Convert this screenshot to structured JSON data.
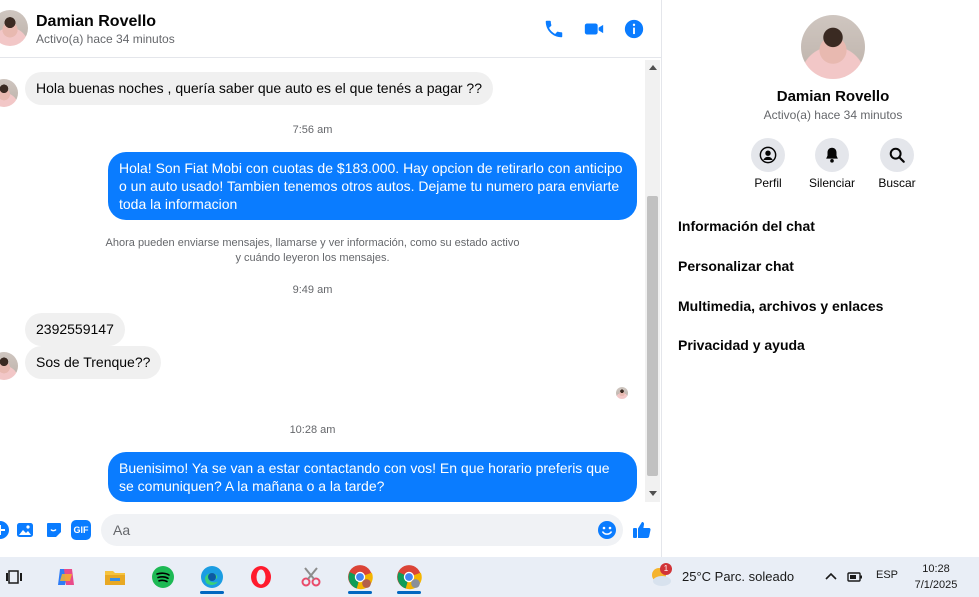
{
  "header": {
    "name": "Damian Rovello",
    "status": "Activo(a) hace 34 minutos",
    "icons": [
      "phone-icon",
      "video-icon",
      "info-icon"
    ]
  },
  "messages": {
    "m1": "Hola buenas noches , quería saber que auto es el que tenés a pagar ??",
    "t1": "7:56 am",
    "m2": "Hola! Son Fiat Mobi con cuotas de $183.000. Hay opcion de retirarlo con anticipo o un auto usado! Tambien tenemos otros autos. Dejame tu numero para enviarte toda la informacion",
    "notice_line1": "Ahora pueden enviarse mensajes, llamarse y ver información, como su estado activo",
    "notice_line2": "y cuándo leyeron los mensajes.",
    "t2": "9:49 am",
    "m3": "2392559147",
    "m4": "Sos de Trenque??",
    "t3": "10:28 am",
    "m5": "Buenisimo! Ya se van a estar contactando con vos! En que horario preferis que se comuniquen? A la mañana o a la tarde?"
  },
  "composer": {
    "placeholder": "Aa",
    "icons": [
      "plus-icon",
      "image-icon",
      "sticker-icon",
      "gif-icon",
      "emoji-icon",
      "thumbs-up-icon"
    ],
    "gif_label": "GIF"
  },
  "info": {
    "name": "Damian Rovello",
    "status": "Activo(a) hace 34 minutos",
    "actions": [
      {
        "label": "Perfil",
        "icon": "profile-icon"
      },
      {
        "label": "Silenciar",
        "icon": "bell-icon"
      },
      {
        "label": "Buscar",
        "icon": "search-icon"
      }
    ],
    "sections": [
      "Información del chat",
      "Personalizar chat",
      "Multimedia, archivos y enlaces",
      "Privacidad y ayuda"
    ]
  },
  "taskbar": {
    "apps": [
      "task-view-icon",
      "copilot-icon",
      "file-explorer-icon",
      "spotify-icon",
      "edge-icon",
      "opera-icon",
      "snipping-tool-icon",
      "chrome-icon",
      "chrome-profile-icon"
    ],
    "weather_badge": "1",
    "weather": "25°C  Parc. soleado",
    "language": "ESP",
    "time": "10:28",
    "date": "7/1/2025"
  },
  "colors": {
    "accent": "#0a7cff",
    "incoming_bubble": "#f0f0f0",
    "taskbar": "#e9eef6"
  }
}
